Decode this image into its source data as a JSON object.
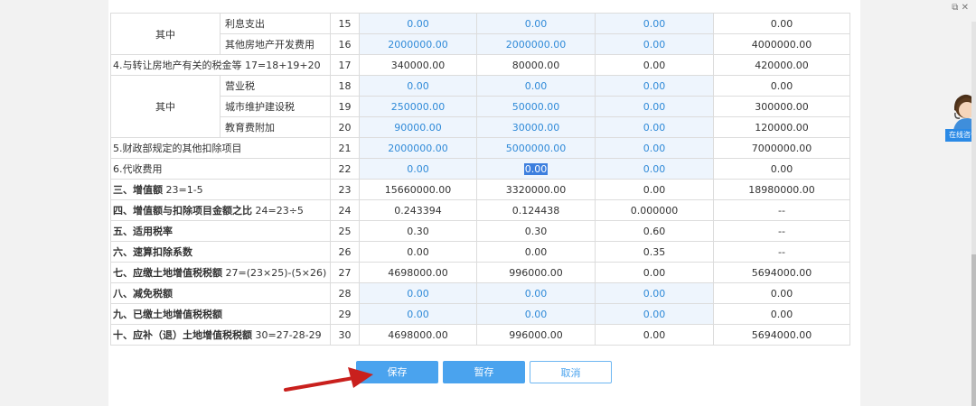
{
  "window": {
    "restore_icon": "⧉",
    "close_icon": "✕"
  },
  "rows": [
    {
      "sub_label": "利息支出",
      "line": "15",
      "c1": "0.00",
      "c2": "0.00",
      "c3": "0.00",
      "total": "0.00"
    },
    {
      "sub_label": "其他房地产开发费用",
      "line": "16",
      "c1": "2000000.00",
      "c2": "2000000.00",
      "c3": "0.00",
      "total": "4000000.00"
    },
    {
      "label": "4.与转让房地产有关的税金等 17=18+19+20",
      "line": "17",
      "c1": "340000.00",
      "c2": "80000.00",
      "c3": "0.00",
      "total": "420000.00"
    },
    {
      "sub_label": "营业税",
      "line": "18",
      "c1": "0.00",
      "c2": "0.00",
      "c3": "0.00",
      "total": "0.00"
    },
    {
      "sub_label": "城市维护建设税",
      "line": "19",
      "c1": "250000.00",
      "c2": "50000.00",
      "c3": "0.00",
      "total": "300000.00"
    },
    {
      "sub_label": "教育费附加",
      "line": "20",
      "c1": "90000.00",
      "c2": "30000.00",
      "c3": "0.00",
      "total": "120000.00"
    },
    {
      "label": "5.财政部规定的其他扣除项目",
      "line": "21",
      "c1": "2000000.00",
      "c2": "5000000.00",
      "c3": "0.00",
      "total": "7000000.00"
    },
    {
      "label": "6.代收费用",
      "line": "22",
      "c1": "0.00",
      "c2": "0.00",
      "c3": "0.00",
      "total": "0.00"
    },
    {
      "label_bold": "三、增值额",
      "label_rest": " 23=1-5",
      "line": "23",
      "c1": "15660000.00",
      "c2": "3320000.00",
      "c3": "0.00",
      "total": "18980000.00"
    },
    {
      "label_bold": "四、增值额与扣除项目金额之比",
      "label_rest": " 24=23÷5",
      "line": "24",
      "c1": "0.243394",
      "c2": "0.124438",
      "c3": "0.000000",
      "total": "--"
    },
    {
      "label_bold": "五、适用税率",
      "label_rest": "",
      "line": "25",
      "c1": "0.30",
      "c2": "0.30",
      "c3": "0.60",
      "total": "--"
    },
    {
      "label_bold": "六、速算扣除系数",
      "label_rest": "",
      "line": "26",
      "c1": "0.00",
      "c2": "0.00",
      "c3": "0.35",
      "total": "--"
    },
    {
      "label_bold": "七、应缴土地增值税税额",
      "label_rest": " 27=(23×25)-(5×26)",
      "line": "27",
      "c1": "4698000.00",
      "c2": "996000.00",
      "c3": "0.00",
      "total": "5694000.00"
    },
    {
      "label_bold": "八、减免税额",
      "label_rest": "",
      "line": "28",
      "c1": "0.00",
      "c2": "0.00",
      "c3": "0.00",
      "total": "0.00"
    },
    {
      "label_bold": "九、已缴土地增值税税额",
      "label_rest": "",
      "line": "29",
      "c1": "0.00",
      "c2": "0.00",
      "c3": "0.00",
      "total": "0.00"
    },
    {
      "label_bold": "十、应补（退）土地增值税税额",
      "label_rest": " 30=27-28-29",
      "line": "30",
      "c1": "4698000.00",
      "c2": "996000.00",
      "c3": "0.00",
      "total": "5694000.00"
    }
  ],
  "group_labels": {
    "first": "其中",
    "second": "其中"
  },
  "buttons": {
    "save": "保存",
    "temp_save": "暂存",
    "cancel": "取消"
  },
  "sidebar": {
    "consult_label": "在线咨询"
  },
  "colors": {
    "accent": "#4aa3ee",
    "editable_cell_bg": "#eef5fd",
    "editable_text": "#2f8ad8",
    "annotation_arrow": "#c9201d"
  }
}
